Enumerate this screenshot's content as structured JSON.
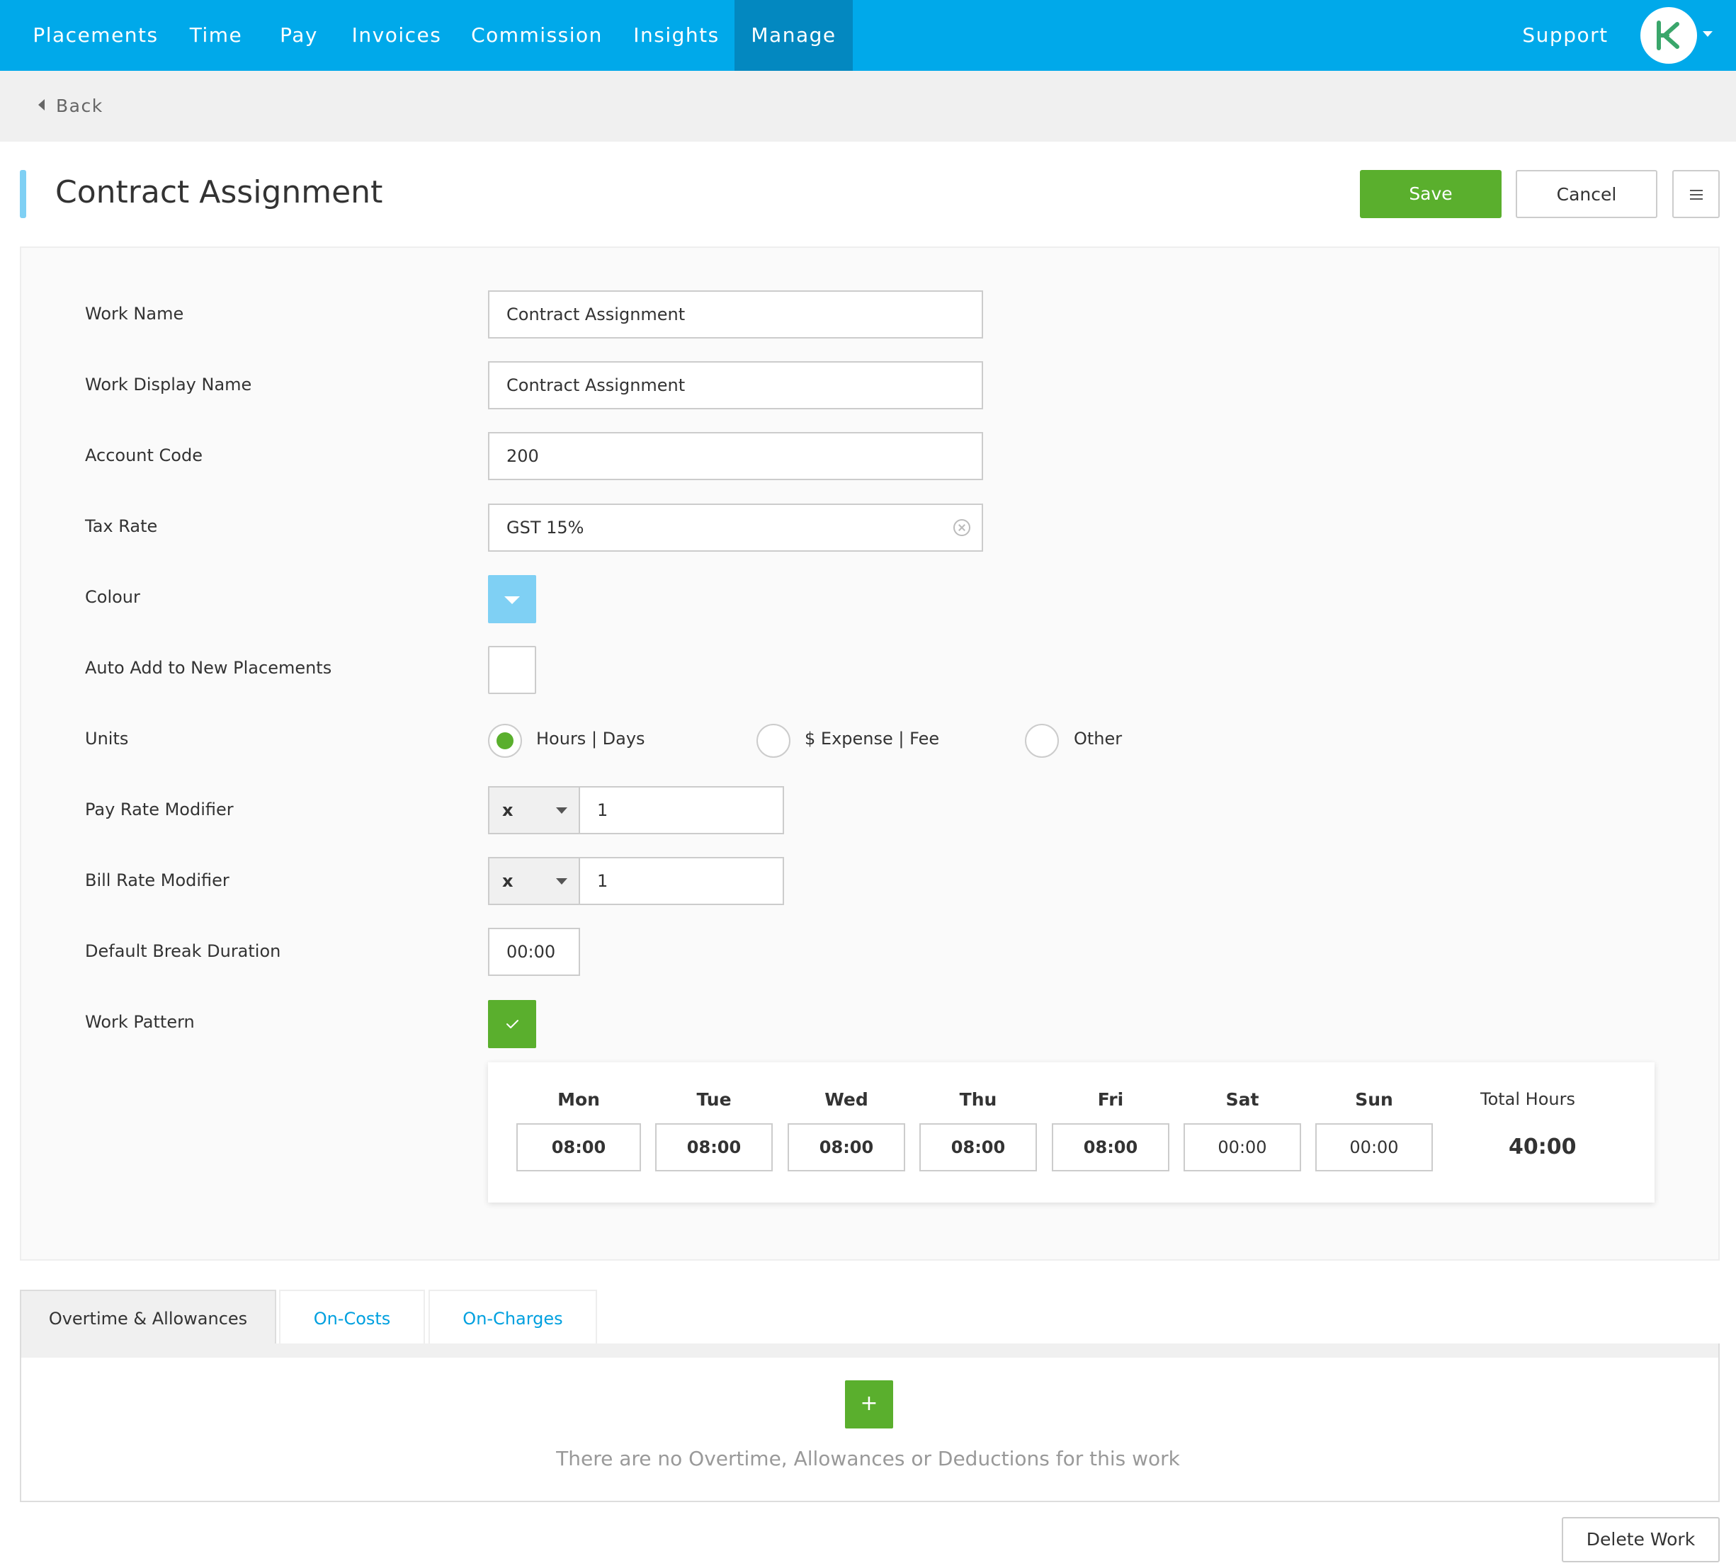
{
  "nav": {
    "items": [
      {
        "label": "Placements"
      },
      {
        "label": "Time"
      },
      {
        "label": "Pay"
      },
      {
        "label": "Invoices"
      },
      {
        "label": "Commission"
      },
      {
        "label": "Insights"
      },
      {
        "label": "Manage",
        "active": true
      }
    ],
    "support_label": "Support",
    "accent_color": "#00a9ea"
  },
  "subbar": {
    "back_label": "Back"
  },
  "header": {
    "title": "Contract Assignment",
    "save_label": "Save",
    "cancel_label": "Cancel"
  },
  "form": {
    "work_name": {
      "label": "Work Name",
      "value": "Contract Assignment"
    },
    "work_display_name": {
      "label": "Work Display Name",
      "value": "Contract Assignment"
    },
    "account_code": {
      "label": "Account Code",
      "value": "200"
    },
    "tax_rate": {
      "label": "Tax Rate",
      "value": "GST 15%"
    },
    "colour": {
      "label": "Colour",
      "value": "#7fd0f4"
    },
    "auto_add": {
      "label": "Auto Add to New Placements",
      "checked": false
    },
    "units": {
      "label": "Units",
      "options": [
        "Hours | Days",
        "$ Expense | Fee",
        "Other"
      ],
      "selected": "Hours | Days"
    },
    "pay_rate_modifier": {
      "label": "Pay Rate Modifier",
      "operator": "x",
      "value": "1"
    },
    "bill_rate_modifier": {
      "label": "Bill Rate Modifier",
      "operator": "x",
      "value": "1"
    },
    "default_break": {
      "label": "Default Break Duration",
      "value": "00:00"
    },
    "work_pattern": {
      "label": "Work Pattern",
      "checked": true
    }
  },
  "work_pattern": {
    "days": [
      {
        "day": "Mon",
        "hours": "08:00"
      },
      {
        "day": "Tue",
        "hours": "08:00"
      },
      {
        "day": "Wed",
        "hours": "08:00"
      },
      {
        "day": "Thu",
        "hours": "08:00"
      },
      {
        "day": "Fri",
        "hours": "08:00"
      },
      {
        "day": "Sat",
        "hours": "00:00"
      },
      {
        "day": "Sun",
        "hours": "00:00"
      }
    ],
    "total_label": "Total Hours",
    "total_value": "40:00"
  },
  "tabs": [
    {
      "label": "Overtime & Allowances",
      "active": true
    },
    {
      "label": "On-Costs"
    },
    {
      "label": "On-Charges"
    }
  ],
  "tab_content": {
    "add_label": "+",
    "empty_message": "There are no Overtime, Allowances or Deductions for this work"
  },
  "footer": {
    "delete_label": "Delete Work"
  },
  "colors": {
    "primary_green": "#5aaf2d",
    "link_blue": "#00a0df"
  }
}
